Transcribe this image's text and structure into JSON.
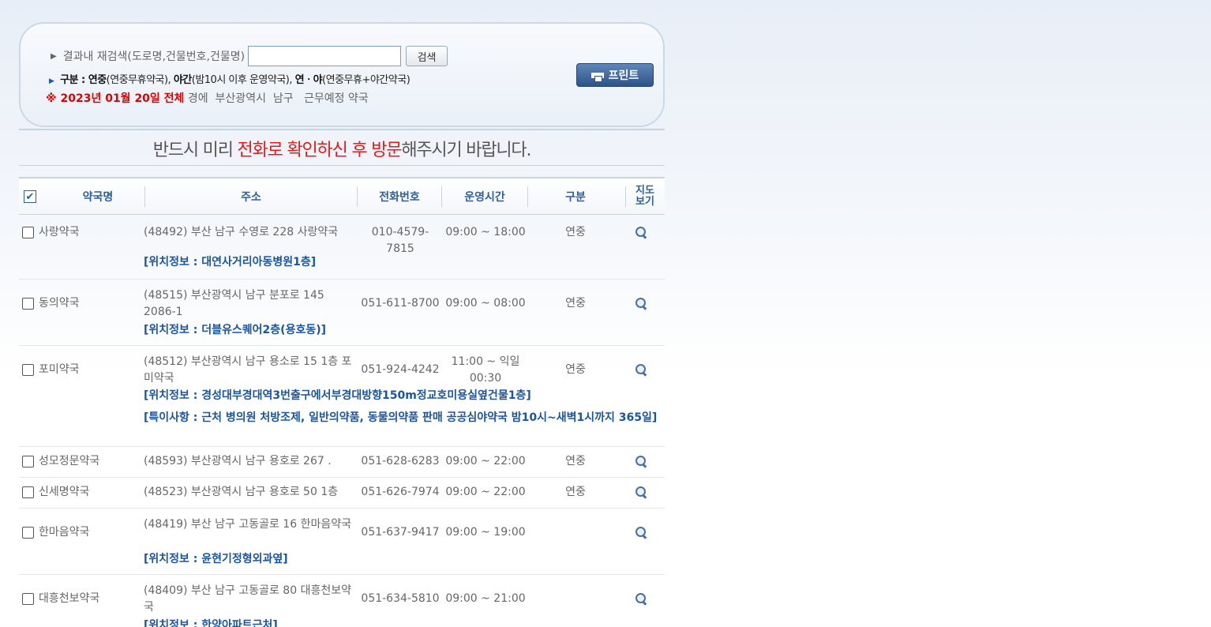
{
  "search": {
    "label": "결과내 재검색(도로명,건물번호,건물명)",
    "value": "",
    "placeholder": "",
    "button": "검색",
    "legend_prefix": "구분 : ",
    "legend_k1": "연중",
    "legend_d1": "(연중무휴약국), ",
    "legend_k2": "야간",
    "legend_d2": "(밤10시 이후 운영약국), ",
    "legend_k3": "연ㆍ야",
    "legend_d3": "(연중무휴+야간약국)",
    "date_red": "※ 2023년 01월 20일 전체",
    "date_rest": " 경에  부산광역시  남구   근무예정 약국"
  },
  "print_button": "프린트",
  "notice": {
    "pre": "반드시 미리 ",
    "hl1": "전화로 확인하신 후 방문",
    "post": "해주시기 바랍니다."
  },
  "headers": {
    "name": "약국명",
    "address": "주소",
    "tel": "전화번호",
    "hours": "운영시간",
    "kind": "구분",
    "map": "지도\n보기"
  },
  "rows": [
    {
      "name": "사랑약국",
      "address": "(48492) 부산 남구 수영로 228 사랑약국",
      "tel": "010-4579-7815",
      "hours": "09:00 ~ 18:00",
      "kind": "연중",
      "info": [
        "[위치정보 : 대연사거리아동병원1층]"
      ]
    },
    {
      "name": "동의약국",
      "address": "(48515) 부산광역시 남구 분포로 145 2086-1",
      "tel": "051-611-8700",
      "hours": "09:00 ~ 08:00",
      "kind": "연중",
      "info": [
        "[위치정보 : 더블유스퀘어2층(용호동)]"
      ]
    },
    {
      "name": "포미약국",
      "address": "(48512) 부산광역시 남구 용소로 15 1층 포미약국",
      "tel": "051-924-4242",
      "hours": "11:00 ~ 익일 00:30",
      "kind": "연중",
      "info": [
        "[위치정보 : 경성대부경대역3번출구에서부경대방향150m정교호미용실옆건물1층]",
        "[특이사항 : 근처 병의원 처방조제, 일반의약품, 동물의약품 판매 공공심야약국 밤10시~새벽1시까지 365일]"
      ]
    },
    {
      "name": "성모정문약국",
      "address": "(48593) 부산광역시 남구 용호로 267 .",
      "tel": "051-628-6283",
      "hours": "09:00 ~ 22:00",
      "kind": "연중",
      "info": []
    },
    {
      "name": "신세명약국",
      "address": "(48523) 부산광역시 남구 용호로 50 1층",
      "tel": "051-626-7974",
      "hours": "09:00 ~ 22:00",
      "kind": "연중",
      "info": []
    },
    {
      "name": "한마음약국",
      "address": "(48419) 부산 남구 고동골로 16 한마음약국",
      "tel": "051-637-9417",
      "hours": "09:00 ~ 19:00",
      "kind": "",
      "info": [
        "[위치정보 : 윤현기정형외과옆]"
      ]
    },
    {
      "name": "대흥천보약국",
      "address": "(48409) 부산 남구 고동골로 80 대흥천보약국",
      "tel": "051-634-5810",
      "hours": "09:00 ~ 21:00",
      "kind": "",
      "info": [
        "[위치정보 : 한양아파트근처]"
      ]
    }
  ]
}
